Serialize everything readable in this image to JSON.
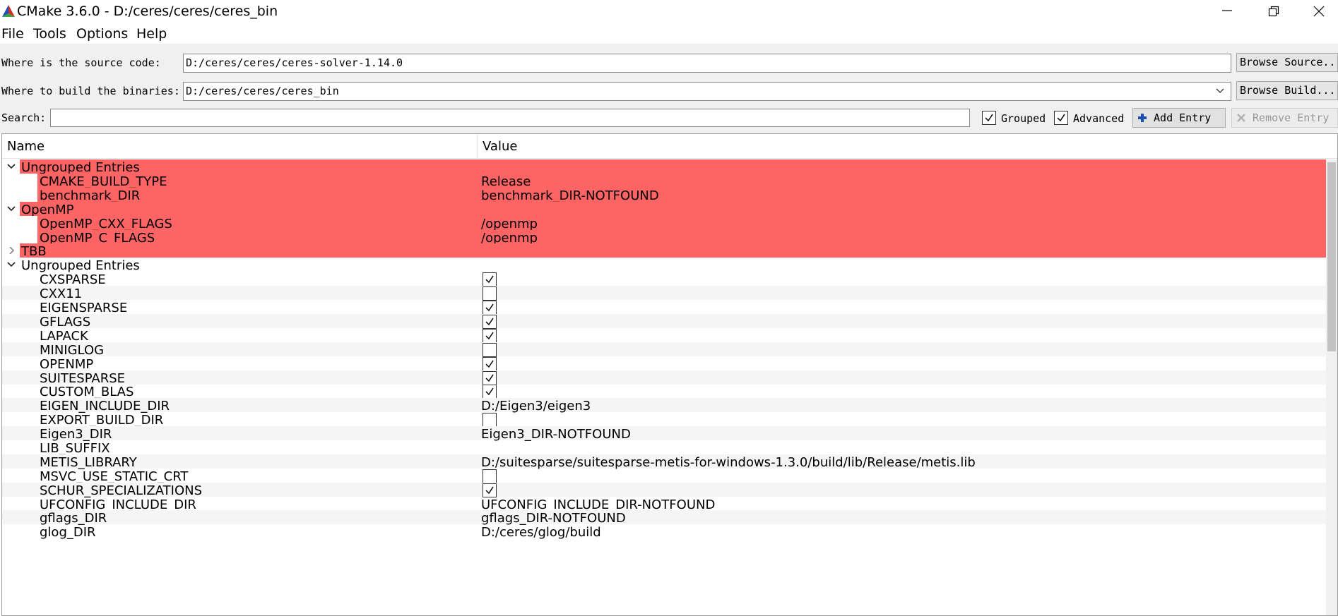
{
  "window": {
    "title": "CMake 3.6.0 - D:/ceres/ceres/ceres_bin",
    "minimize_label": "minimize",
    "maximize_label": "restore",
    "close_label": "close"
  },
  "menu": {
    "items": [
      "File",
      "Tools",
      "Options",
      "Help"
    ]
  },
  "source": {
    "label": "Where is the source code:",
    "value": "D:/ceres/ceres/ceres-solver-1.14.0",
    "browse_label": "Browse Source..."
  },
  "build": {
    "label": "Where to build the binaries:",
    "value": "D:/ceres/ceres/ceres_bin",
    "browse_label": "Browse Build..."
  },
  "search": {
    "label": "Search:",
    "value": ""
  },
  "options": {
    "grouped_label": "Grouped",
    "grouped_checked": true,
    "advanced_label": "Advanced",
    "advanced_checked": true,
    "add_entry_label": "Add Entry",
    "remove_entry_label": "Remove Entry"
  },
  "table": {
    "col_name": "Name",
    "col_value": "Value",
    "highlight_color": "#ff6464",
    "rows": [
      {
        "type": "group",
        "name": "Ungrouped Entries",
        "expanded": true,
        "new": true
      },
      {
        "type": "entry",
        "name": "CMAKE_BUILD_TYPE",
        "value": "Release",
        "new": true
      },
      {
        "type": "entry",
        "name": "benchmark_DIR",
        "value": "benchmark_DIR-NOTFOUND",
        "new": true
      },
      {
        "type": "group",
        "name": "OpenMP",
        "expanded": true,
        "new": true
      },
      {
        "type": "entry",
        "name": "OpenMP_CXX_FLAGS",
        "value": "/openmp",
        "new": true
      },
      {
        "type": "entry",
        "name": "OpenMP_C_FLAGS",
        "value": "/openmp",
        "new": true
      },
      {
        "type": "group",
        "name": "TBB",
        "expanded": false,
        "new": true
      },
      {
        "type": "group",
        "name": "Ungrouped Entries",
        "expanded": true,
        "new": false
      },
      {
        "type": "bool",
        "name": "CXSPARSE",
        "checked": true
      },
      {
        "type": "bool",
        "name": "CXX11",
        "checked": false
      },
      {
        "type": "bool",
        "name": "EIGENSPARSE",
        "checked": true
      },
      {
        "type": "bool",
        "name": "GFLAGS",
        "checked": true
      },
      {
        "type": "bool",
        "name": "LAPACK",
        "checked": true
      },
      {
        "type": "bool",
        "name": "MINIGLOG",
        "checked": false
      },
      {
        "type": "bool",
        "name": "OPENMP",
        "checked": true
      },
      {
        "type": "bool",
        "name": "SUITESPARSE",
        "checked": true
      },
      {
        "type": "bool",
        "name": "CUSTOM_BLAS",
        "checked": true
      },
      {
        "type": "entry",
        "name": "EIGEN_INCLUDE_DIR",
        "value": "D:/Eigen3/eigen3"
      },
      {
        "type": "bool",
        "name": "EXPORT_BUILD_DIR",
        "checked": false
      },
      {
        "type": "entry",
        "name": "Eigen3_DIR",
        "value": "Eigen3_DIR-NOTFOUND"
      },
      {
        "type": "entry",
        "name": "LIB_SUFFIX",
        "value": ""
      },
      {
        "type": "entry",
        "name": "METIS_LIBRARY",
        "value": "D:/suitesparse/suitesparse-metis-for-windows-1.3.0/build/lib/Release/metis.lib"
      },
      {
        "type": "bool",
        "name": "MSVC_USE_STATIC_CRT",
        "checked": false
      },
      {
        "type": "bool",
        "name": "SCHUR_SPECIALIZATIONS",
        "checked": true
      },
      {
        "type": "entry",
        "name": "UFCONFIG_INCLUDE_DIR",
        "value": "UFCONFIG_INCLUDE_DIR-NOTFOUND"
      },
      {
        "type": "entry",
        "name": "gflags_DIR",
        "value": "gflags_DIR-NOTFOUND"
      },
      {
        "type": "entry",
        "name": "glog_DIR",
        "value": "D:/ceres/glog/build"
      }
    ]
  }
}
